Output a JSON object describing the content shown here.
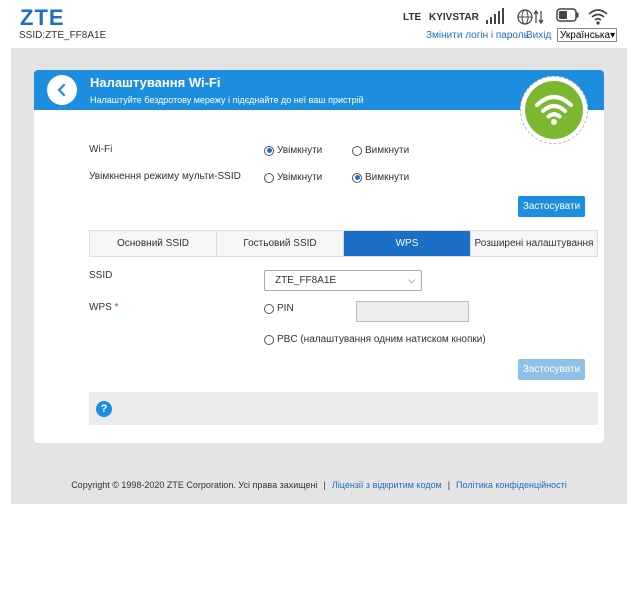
{
  "header": {
    "logo": "ZTE",
    "ssid_line": "SSID:ZTE_FF8A1E",
    "network_type": "LTE",
    "operator": "KYIVSTAR",
    "links": {
      "change_login": "Змінити логін і пароль",
      "logout": "Вихід"
    },
    "language": "Українська"
  },
  "page": {
    "title": "Налаштування Wi-Fi",
    "subtitle": "Налаштуйте бездротову мережу і підєднайте до неї ваш пристрій"
  },
  "wifi_settings": {
    "wifi_label": "Wi-Fi",
    "wifi_on": "Увімкнути",
    "wifi_off": "Вимкнути",
    "multi_ssid_label": "Увімкнення режиму мульти-SSID",
    "multi_on": "Увімкнути",
    "multi_off": "Вимкнути",
    "apply": "Застосувати"
  },
  "tabs": [
    {
      "label": "Основний SSID"
    },
    {
      "label": "Гостьовий SSID"
    },
    {
      "label": "WPS"
    },
    {
      "label": "Розширені налаштування"
    }
  ],
  "wps": {
    "ssid_label": "SSID",
    "ssid_value": "ZTE_FF8A1E",
    "wps_label": "WPS",
    "required_mark": "*",
    "pin_option": "PIN",
    "pin_value": "",
    "pbc_option": "PBC (налаштування одним натиском кнопки)",
    "apply": "Застосувати"
  },
  "help": {
    "icon": "?"
  },
  "footer": {
    "copyright": "Copyright © 1998-2020 ZTE Corporation. Усі права захищені",
    "sep1": "|",
    "licenses": "Ліцензії з відкритим кодом",
    "sep2": "|",
    "privacy": "Політика конфіденційності"
  },
  "colors": {
    "accent": "#1c8ddf",
    "dark_accent": "#1c6fc7",
    "wifi_green": "#7cb82f"
  }
}
